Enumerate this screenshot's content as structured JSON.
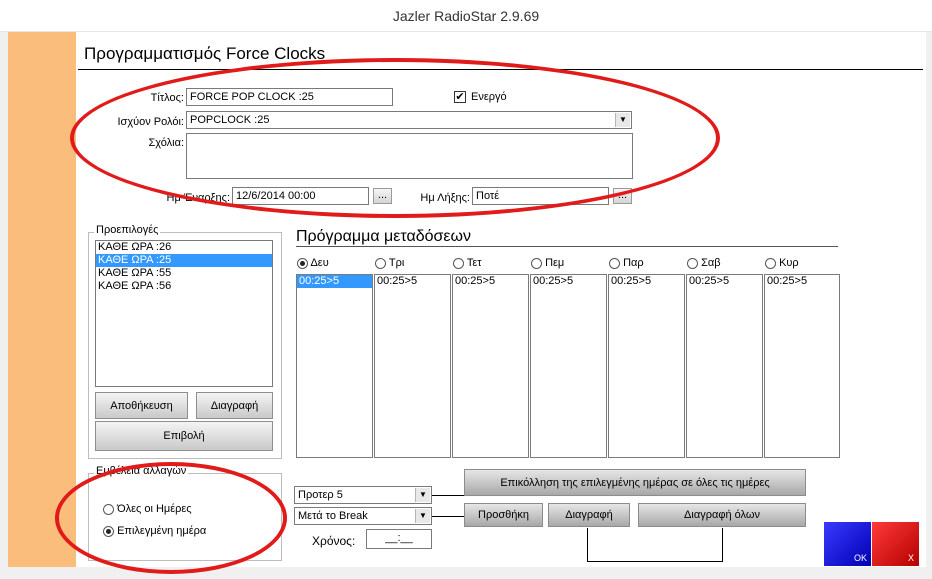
{
  "window": {
    "title": "Jazler RadioStar 2.9.69"
  },
  "page": {
    "title": "Προγραμματισμός Force Clocks"
  },
  "form": {
    "title_label": "Τίτλος:",
    "title_value": "FORCE POP CLOCK :25",
    "active_label": "Ενεργό",
    "active_checked": true,
    "active_mark": "✔",
    "clock_label": "Ισχύον Ρολόι:",
    "clock_value": "POPCLOCK :25",
    "comments_label": "Σχόλια:",
    "comments_value": "",
    "start_label": "Ημ Έναρξης:",
    "start_value": "12/6/2014 00:00",
    "end_label": "Ημ Λήξης:",
    "end_value": "Ποτέ",
    "dots": "..."
  },
  "presets": {
    "group_title": "Προεπιλογές",
    "items": [
      {
        "label": "ΚΑΘΕ ΩΡΑ :26",
        "selected": false
      },
      {
        "label": "ΚΑΘΕ ΩΡΑ :25",
        "selected": true
      },
      {
        "label": "ΚΑΘΕ ΩΡΑ :55",
        "selected": false
      },
      {
        "label": "ΚΑΘΕ ΩΡΑ :56",
        "selected": false
      }
    ],
    "save_label": "Αποθήκευση",
    "delete_label": "Διαγραφή",
    "apply_label": "Επιβολή"
  },
  "schedule": {
    "title": "Πρόγραμμα μεταδόσεων",
    "days": [
      {
        "label": "Δευ",
        "selected": true,
        "entries": [
          "00:25>5"
        ],
        "entry_selected": true
      },
      {
        "label": "Τρι",
        "selected": false,
        "entries": [
          "00:25>5"
        ],
        "entry_selected": false
      },
      {
        "label": "Τετ",
        "selected": false,
        "entries": [
          "00:25>5"
        ],
        "entry_selected": false
      },
      {
        "label": "Πεμ",
        "selected": false,
        "entries": [
          "00:25>5"
        ],
        "entry_selected": false
      },
      {
        "label": "Παρ",
        "selected": false,
        "entries": [
          "00:25>5"
        ],
        "entry_selected": false
      },
      {
        "label": "Σαβ",
        "selected": false,
        "entries": [
          "00:25>5"
        ],
        "entry_selected": false
      },
      {
        "label": "Κυρ",
        "selected": false,
        "entries": [
          "00:25>5"
        ],
        "entry_selected": false
      }
    ]
  },
  "scope": {
    "group_title": "Εμβέλεια αλλαγών",
    "all_days_label": "Όλες οι Ημέρες",
    "selected_day_label": "Επιλεγμένη ημέρα",
    "selected_option": "selected_day"
  },
  "controls": {
    "position_value": "Προτερ 5",
    "break_value": "Μετά το Break",
    "time_label": "Χρόνος:",
    "time_value": "__:__",
    "paste_all_label": "Επικόλληση της επιλεγμένης ημέρας σε όλες τις ημέρες",
    "add_label": "Προσθήκη",
    "delete_label": "Διαγραφή",
    "delete_all_label": "Διαγραφή όλων"
  },
  "dialog": {
    "ok_label": "OK",
    "cancel_label": "X",
    "ok_color": "#1010e0",
    "cancel_color": "#e01010"
  },
  "annotation": {
    "color": "#e11a1a"
  }
}
